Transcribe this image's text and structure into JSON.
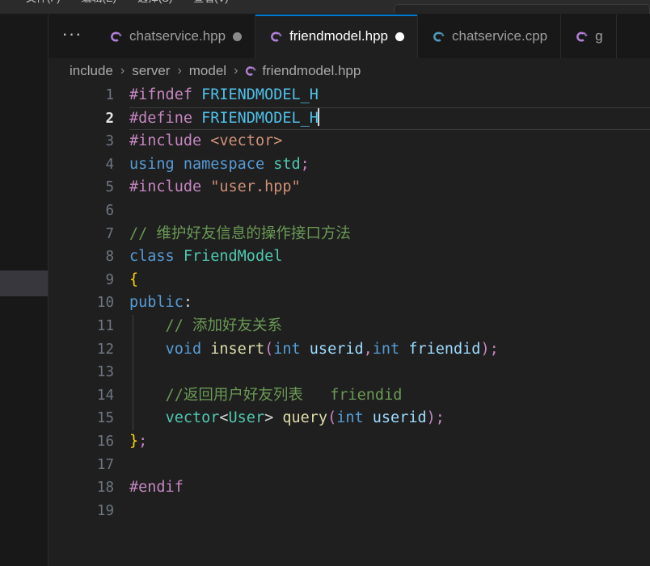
{
  "window": {
    "menu_items": [
      "文件(F)",
      "编辑(E)",
      "选择(S)",
      "查看(V)"
    ],
    "command_center_value": ""
  },
  "colors": {
    "accent": "#0078d4",
    "editor_bg": "#1f1f1f",
    "sidebar_bg": "#181818",
    "tabbar_bg": "#181818",
    "active_tab_bg": "#1f1f1f",
    "line_number": "#6e7681",
    "dirty_dot": "#ffffff"
  },
  "tabbar": {
    "overflow_label": "···",
    "tabs": [
      {
        "label": "chatservice.hpp",
        "icon": "cpp-header-file-icon",
        "icon_color": "#b180d7",
        "dirty": true,
        "active": false
      },
      {
        "label": "friendmodel.hpp",
        "icon": "cpp-header-file-icon",
        "icon_color": "#b180d7",
        "dirty": true,
        "active": true
      },
      {
        "label": "chatservice.cpp",
        "icon": "cpp-source-file-icon",
        "icon_color": "#519aba",
        "dirty": false,
        "active": false
      },
      {
        "label": "g",
        "icon": "cpp-header-file-icon",
        "icon_color": "#b180d7",
        "dirty": false,
        "active": false
      }
    ]
  },
  "breadcrumb": {
    "separator": "›",
    "items": [
      "include",
      "server",
      "model"
    ],
    "file": "friendmodel.hpp",
    "file_icon": "cpp-header-file-icon"
  },
  "editor": {
    "active_line": 2,
    "cursor_line": 2,
    "lines": [
      {
        "n": 1,
        "indent": 0,
        "tokens": [
          {
            "t": "#ifndef",
            "c": "t-pre"
          },
          {
            "t": " ",
            "c": "t-plain"
          },
          {
            "t": "FRIENDMODEL_H",
            "c": "t-macro"
          }
        ]
      },
      {
        "n": 2,
        "indent": 0,
        "cursor": true,
        "tokens": [
          {
            "t": "#define",
            "c": "t-pre"
          },
          {
            "t": " ",
            "c": "t-plain"
          },
          {
            "t": "FRIENDMODEL_H",
            "c": "t-macro"
          }
        ]
      },
      {
        "n": 3,
        "indent": 0,
        "tokens": [
          {
            "t": "#include",
            "c": "t-pre"
          },
          {
            "t": " ",
            "c": "t-plain"
          },
          {
            "t": "<vector>",
            "c": "t-inc"
          }
        ]
      },
      {
        "n": 4,
        "indent": 0,
        "tokens": [
          {
            "t": "using",
            "c": "t-kw"
          },
          {
            "t": " ",
            "c": "t-plain"
          },
          {
            "t": "namespace",
            "c": "t-kw"
          },
          {
            "t": " ",
            "c": "t-plain"
          },
          {
            "t": "std",
            "c": "t-type"
          },
          {
            "t": ";",
            "c": "t-punc"
          }
        ]
      },
      {
        "n": 5,
        "indent": 0,
        "tokens": [
          {
            "t": "#include",
            "c": "t-pre"
          },
          {
            "t": " ",
            "c": "t-plain"
          },
          {
            "t": "\"user.hpp\"",
            "c": "t-str"
          }
        ]
      },
      {
        "n": 6,
        "indent": 0,
        "tokens": []
      },
      {
        "n": 7,
        "indent": 0,
        "tokens": [
          {
            "t": "// 维护好友信息的操作接口方法",
            "c": "t-cmt"
          }
        ]
      },
      {
        "n": 8,
        "indent": 0,
        "tokens": [
          {
            "t": "class",
            "c": "t-kw"
          },
          {
            "t": " ",
            "c": "t-plain"
          },
          {
            "t": "FriendModel",
            "c": "t-type"
          }
        ]
      },
      {
        "n": 9,
        "indent": 0,
        "tokens": [
          {
            "t": "{",
            "c": "t-brace"
          }
        ]
      },
      {
        "n": 10,
        "indent": 0,
        "tokens": [
          {
            "t": "public",
            "c": "t-kw"
          },
          {
            "t": ":",
            "c": "t-plain"
          }
        ]
      },
      {
        "n": 11,
        "indent": 1,
        "tokens": [
          {
            "t": "    // 添加好友关系",
            "c": "t-cmt"
          }
        ]
      },
      {
        "n": 12,
        "indent": 1,
        "tokens": [
          {
            "t": "    ",
            "c": "t-plain"
          },
          {
            "t": "void",
            "c": "t-kw"
          },
          {
            "t": " ",
            "c": "t-plain"
          },
          {
            "t": "insert",
            "c": "t-fn"
          },
          {
            "t": "(",
            "c": "t-punc"
          },
          {
            "t": "int",
            "c": "t-kw"
          },
          {
            "t": " ",
            "c": "t-plain"
          },
          {
            "t": "userid",
            "c": "t-var"
          },
          {
            "t": ",",
            "c": "t-punc"
          },
          {
            "t": "int",
            "c": "t-kw"
          },
          {
            "t": " ",
            "c": "t-plain"
          },
          {
            "t": "friendid",
            "c": "t-var"
          },
          {
            "t": ")",
            "c": "t-punc"
          },
          {
            "t": ";",
            "c": "t-punc"
          }
        ]
      },
      {
        "n": 13,
        "indent": 1,
        "tokens": []
      },
      {
        "n": 14,
        "indent": 1,
        "tokens": [
          {
            "t": "    //返回用户好友列表   friendid",
            "c": "t-cmt"
          }
        ]
      },
      {
        "n": 15,
        "indent": 1,
        "tokens": [
          {
            "t": "    ",
            "c": "t-plain"
          },
          {
            "t": "vector",
            "c": "t-type"
          },
          {
            "t": "<",
            "c": "t-op"
          },
          {
            "t": "User",
            "c": "t-type"
          },
          {
            "t": ">",
            "c": "t-op"
          },
          {
            "t": " ",
            "c": "t-plain"
          },
          {
            "t": "query",
            "c": "t-fn"
          },
          {
            "t": "(",
            "c": "t-punc"
          },
          {
            "t": "int",
            "c": "t-kw"
          },
          {
            "t": " ",
            "c": "t-plain"
          },
          {
            "t": "userid",
            "c": "t-var"
          },
          {
            "t": ")",
            "c": "t-punc"
          },
          {
            "t": ";",
            "c": "t-punc"
          }
        ]
      },
      {
        "n": 16,
        "indent": 0,
        "tokens": [
          {
            "t": "}",
            "c": "t-brace"
          },
          {
            "t": ";",
            "c": "t-punc"
          }
        ]
      },
      {
        "n": 17,
        "indent": 0,
        "tokens": []
      },
      {
        "n": 18,
        "indent": 0,
        "tokens": [
          {
            "t": "#endif",
            "c": "t-pre"
          }
        ]
      },
      {
        "n": 19,
        "indent": 0,
        "tokens": []
      }
    ]
  }
}
